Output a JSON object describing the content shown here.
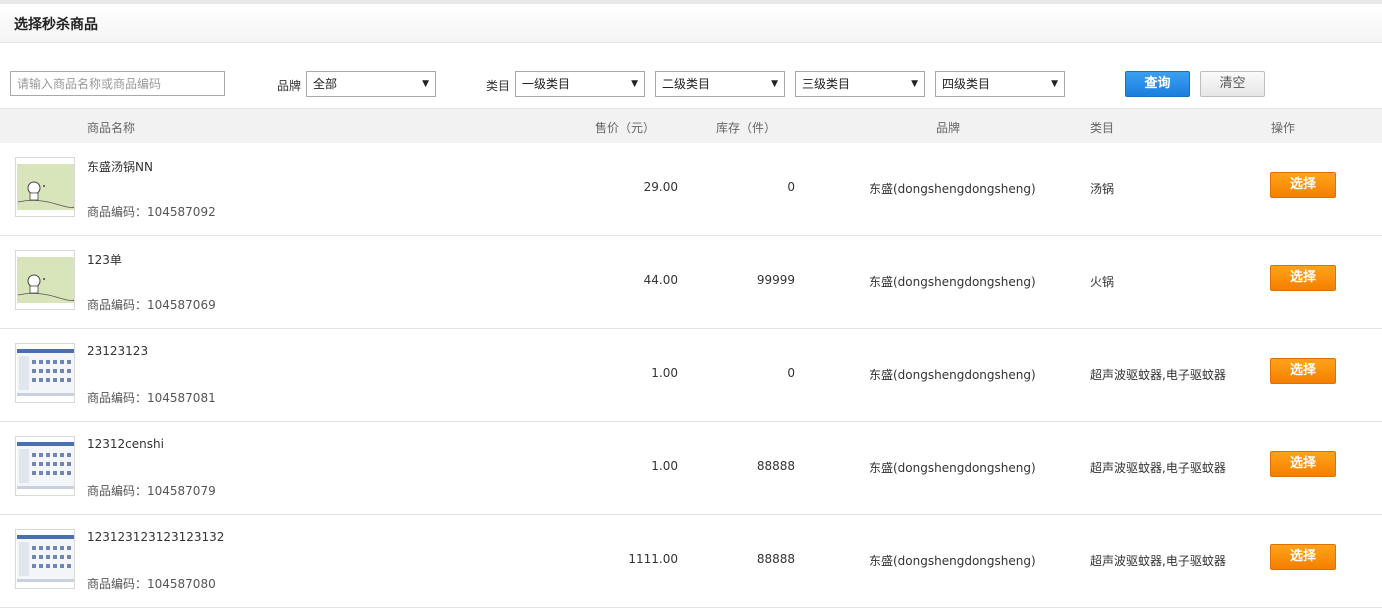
{
  "page": {
    "title": "选择秒杀商品"
  },
  "filters": {
    "search_placeholder": "请输入商品名称或商品编码",
    "brand_label": "品牌",
    "brand_value": "全部",
    "category_label": "类目",
    "cat1_value": "一级类目",
    "cat2_value": "二级类目",
    "cat3_value": "三级类目",
    "cat4_value": "四级类目",
    "query_label": "查询",
    "clear_label": "清空"
  },
  "table": {
    "headers": {
      "name": "商品名称",
      "price": "售价（元）",
      "stock": "库存（件）",
      "brand": "品牌",
      "category": "类目",
      "action": "操作"
    },
    "rows": [
      {
        "name": "东盛汤锅NN",
        "code": "商品编码：104587092",
        "price": "29.00",
        "stock": "0",
        "brand": "东盛(dongshengdongsheng)",
        "category": "汤锅",
        "action": "选择",
        "thumb": "cartoon"
      },
      {
        "name": "123单",
        "code": "商品编码：104587069",
        "price": "44.00",
        "stock": "99999",
        "brand": "东盛(dongshengdongsheng)",
        "category": "火锅",
        "action": "选择",
        "thumb": "cartoon"
      },
      {
        "name": "23123123",
        "code": "商品编码：104587081",
        "price": "1.00",
        "stock": "0",
        "brand": "东盛(dongshengdongsheng)",
        "category": "超声波驱蚊器,电子驱蚊器",
        "action": "选择",
        "thumb": "screenshot"
      },
      {
        "name": "12312censhi",
        "code": "商品编码：104587079",
        "price": "1.00",
        "stock": "88888",
        "brand": "东盛(dongshengdongsheng)",
        "category": "超声波驱蚊器,电子驱蚊器",
        "action": "选择",
        "thumb": "screenshot"
      },
      {
        "name": "123123123123123132",
        "code": "商品编码：104587080",
        "price": "1111.00",
        "stock": "88888",
        "brand": "东盛(dongshengdongsheng)",
        "category": "超声波驱蚊器,电子驱蚊器",
        "action": "选择",
        "thumb": "screenshot"
      }
    ]
  },
  "colors": {
    "query_button": "#1a7fdc",
    "select_button": "#f57f00"
  },
  "icons": {
    "dropdown": "chevron-down-icon"
  }
}
